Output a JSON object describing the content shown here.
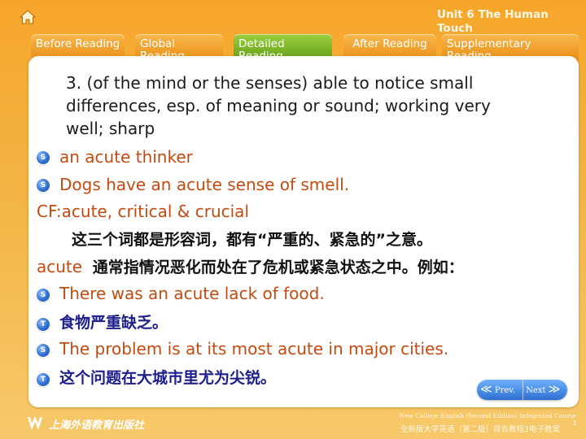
{
  "header": {
    "unit_title": "Unit 6 The Human Touch",
    "tabs": [
      {
        "label": "Before Reading"
      },
      {
        "label": "Global Reading"
      },
      {
        "label": "Detailed Reading"
      },
      {
        "label": "After Reading"
      },
      {
        "label": "Supplementary Reading"
      }
    ],
    "active_tab": "Detailed Reading"
  },
  "content": {
    "definition": "3. (of the mind or the senses) able to notice small differences, esp. of meaning or sound; working very well; sharp",
    "examples1": [
      {
        "badge": "S",
        "text": "an acute thinker"
      },
      {
        "badge": "S",
        "text": "Dogs have an acute sense of smell."
      }
    ],
    "cf_label": "CF:",
    "cf_text": "acute, critical & crucial",
    "cf_note": "这三个词都是形容词，都有“严重的、紧急的”之意。",
    "acute_word": "acute",
    "acute_note": "通常指情况恶化而处在了危机或紧急状态之中。例如：",
    "examples2": [
      {
        "badge": "S",
        "text": "There was an acute lack of food.",
        "lang": "en"
      },
      {
        "badge": "T",
        "text": "食物严重缺乏。",
        "lang": "zh"
      },
      {
        "badge": "S",
        "text": "The problem is at its most acute in major cities.",
        "lang": "en"
      },
      {
        "badge": "T",
        "text": "这个问题在大城市里尤为尖锐。",
        "lang": "zh"
      }
    ]
  },
  "nav": {
    "prev_label": "Prev.",
    "next_label": "Next",
    "prev_arrow": "≪",
    "next_arrow": "≫"
  },
  "footer": {
    "publisher": "上海外语教育出版社",
    "course_en": "New College English (Second Edition) Integrated Course 3",
    "course_zh": "全新版大学英语（第二版）综合教程3电子教案"
  },
  "colors": {
    "background": "#f6a62a",
    "tab": "#e98c12",
    "active_tab": "#6aa61d",
    "example_text": "#c44a10",
    "translation_text": "#1d1d8c",
    "badge": "#2f6fd1"
  }
}
